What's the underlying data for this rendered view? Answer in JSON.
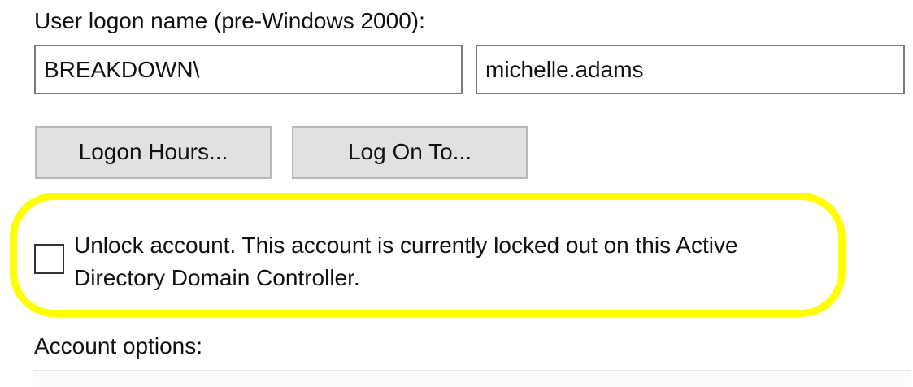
{
  "logon": {
    "label": "User logon name (pre-Windows 2000):",
    "domain_value": "BREAKDOWN\\",
    "username_value": "michelle.adams"
  },
  "buttons": {
    "logon_hours": "Logon Hours...",
    "log_on_to": "Log On To..."
  },
  "unlock": {
    "checked": false,
    "line1": "Unlock account. This account is currently locked out on this Active",
    "line2": "Directory Domain Controller.",
    "highlight_color": "#ffff00"
  },
  "account_options": {
    "label": "Account options:"
  }
}
